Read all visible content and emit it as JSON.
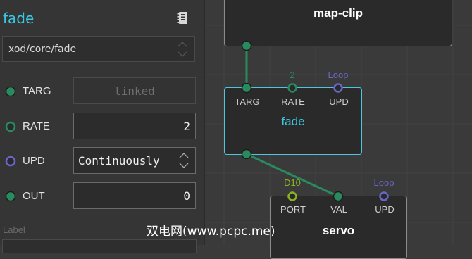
{
  "inspector": {
    "title": "fade",
    "doc_icon": "doc-icon",
    "node_type_path": "xod/core/fade",
    "pins": [
      {
        "label": "TARG",
        "type": "linked",
        "value": "linked",
        "color": "#2a8a5f"
      },
      {
        "label": "RATE",
        "type": "number",
        "value": "2",
        "color": "#2a8a5f"
      },
      {
        "label": "UPD",
        "type": "select",
        "value": "Continuously",
        "color": "#6a65c8"
      },
      {
        "label": "OUT",
        "type": "number",
        "value": "0",
        "color": "#2a8a5f"
      }
    ],
    "label_caption": "Label"
  },
  "canvas": {
    "nodes": {
      "map_clip": {
        "title": "map-clip"
      },
      "fade": {
        "title": "fade",
        "pins": [
          {
            "name": "TARG",
            "value": ""
          },
          {
            "name": "RATE",
            "value": "2"
          },
          {
            "name": "UPD",
            "value": "Loop"
          }
        ]
      },
      "servo": {
        "title": "servo",
        "pins": [
          {
            "name": "PORT",
            "value": "D10"
          },
          {
            "name": "VAL",
            "value": ""
          },
          {
            "name": "UPD",
            "value": "Loop"
          }
        ]
      }
    }
  },
  "colors": {
    "accent": "#39c9e6",
    "number_pin": "#2a8a5f",
    "pulse_pin": "#6a65c8",
    "port_pin": "#8ab31f",
    "link": "#2a8a5f"
  },
  "watermark": "双电网(www.pcpc.me)"
}
